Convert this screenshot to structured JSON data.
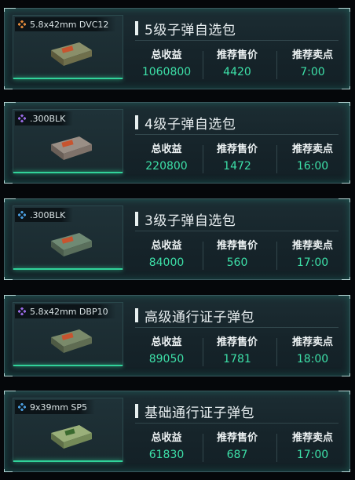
{
  "labels": {
    "revenue": "总收益",
    "price": "推荐售价",
    "time": "推荐卖点"
  },
  "colors": {
    "value": "#3de0a8",
    "accent": "#31d39a",
    "tier_gold": "#e28a3a",
    "tier_purple": "#9a6be6",
    "tier_blue": "#4a9ee0"
  },
  "cards": [
    {
      "tag": "5.8x42mm DVC12",
      "tier_icon": "tier-gold-diamond-icon",
      "title": "5级子弹自选包",
      "revenue": "1060800",
      "price": "4420",
      "time": "7:00"
    },
    {
      "tag": ".300BLK",
      "tier_icon": "tier-purple-diamond-icon",
      "title": "4级子弹自选包",
      "revenue": "220800",
      "price": "1472",
      "time": "16:00"
    },
    {
      "tag": ".300BLK",
      "tier_icon": "tier-blue-diamond-icon",
      "title": "3级子弹自选包",
      "revenue": "84000",
      "price": "560",
      "time": "17:00"
    },
    {
      "tag": "5.8x42mm DBP10",
      "tier_icon": "tier-purple-diamond-icon",
      "title": "高级通行证子弹包",
      "revenue": "89050",
      "price": "1781",
      "time": "18:00"
    },
    {
      "tag": "9x39mm SP5",
      "tier_icon": "tier-blue-diamond-icon",
      "title": "基础通行证子弹包",
      "revenue": "61830",
      "price": "687",
      "time": "17:00"
    }
  ]
}
